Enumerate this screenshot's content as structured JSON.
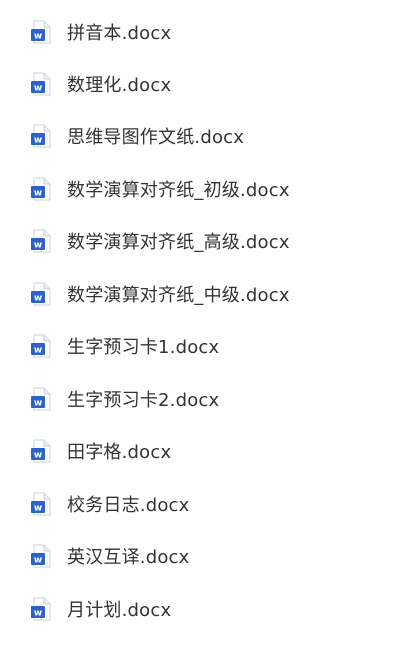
{
  "files": [
    {
      "name": "拼音本.docx",
      "icon": "word-doc-icon"
    },
    {
      "name": "数理化.docx",
      "icon": "word-doc-icon"
    },
    {
      "name": "思维导图作文纸.docx",
      "icon": "word-doc-icon"
    },
    {
      "name": "数学演算对齐纸_初级.docx",
      "icon": "word-doc-icon"
    },
    {
      "name": "数学演算对齐纸_高级.docx",
      "icon": "word-doc-icon"
    },
    {
      "name": "数学演算对齐纸_中级.docx",
      "icon": "word-doc-icon"
    },
    {
      "name": "生字预习卡1.docx",
      "icon": "word-doc-icon"
    },
    {
      "name": "生字预习卡2.docx",
      "icon": "word-doc-icon"
    },
    {
      "name": "田字格.docx",
      "icon": "word-doc-icon"
    },
    {
      "name": "校务日志.docx",
      "icon": "word-doc-icon"
    },
    {
      "name": "英汉互译.docx",
      "icon": "word-doc-icon"
    },
    {
      "name": "月计划.docx",
      "icon": "word-doc-icon"
    }
  ],
  "colors": {
    "text": "#333333",
    "icon_blue": "#2b63c9",
    "icon_paper": "#ffffff",
    "icon_outline": "#c9d3e3"
  }
}
